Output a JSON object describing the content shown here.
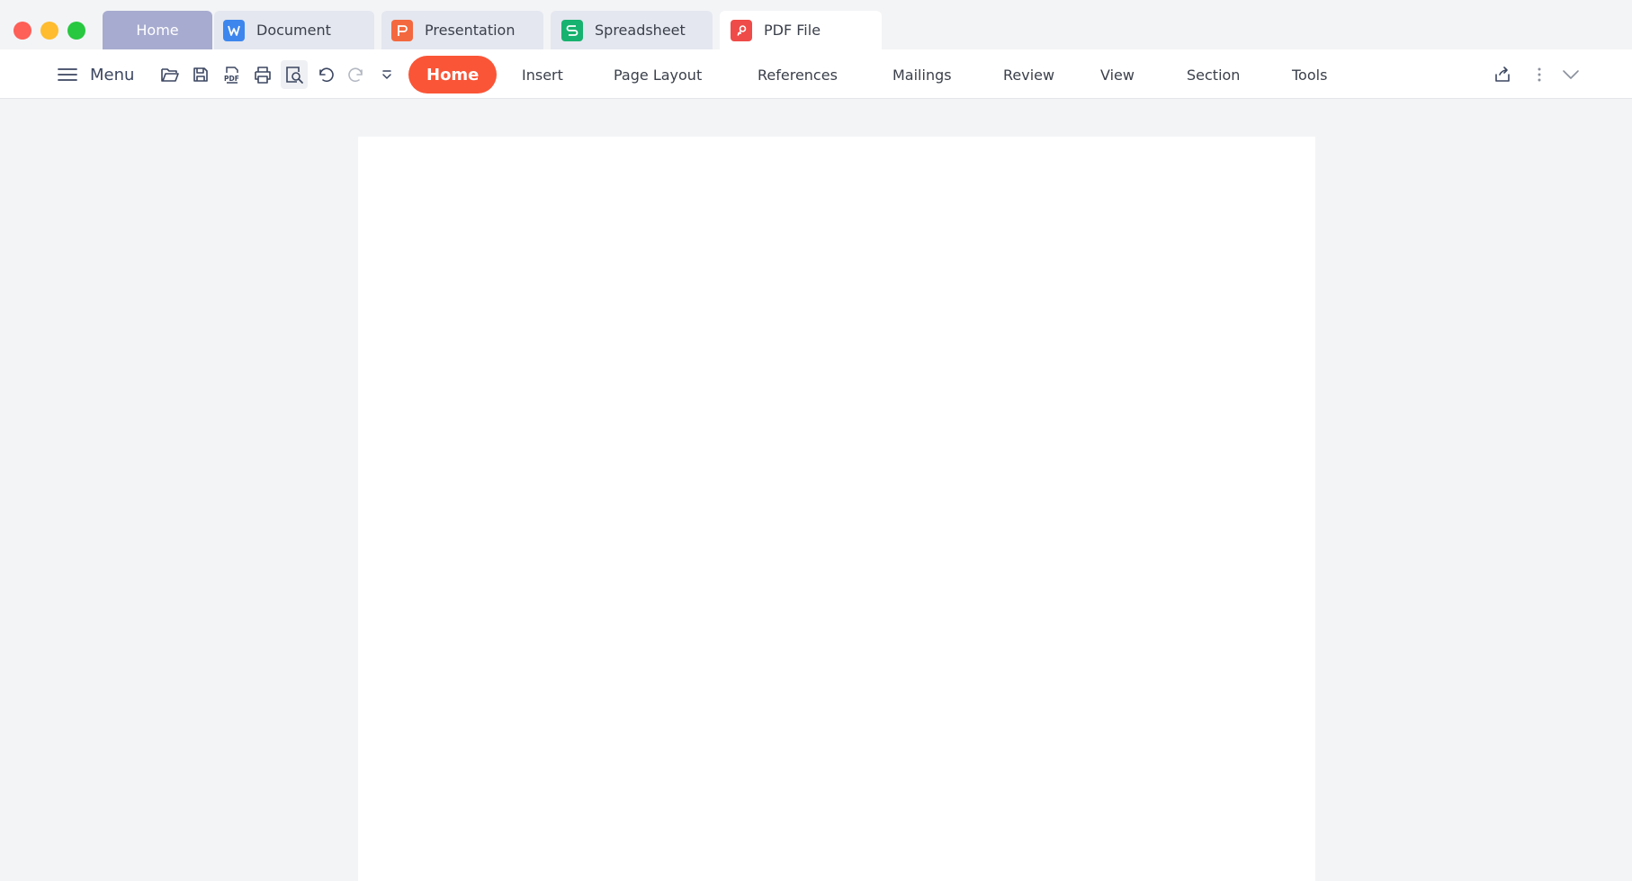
{
  "window": {
    "controls": [
      "close",
      "minimize",
      "maximize"
    ]
  },
  "tabs": [
    {
      "label": "Home",
      "icon": null,
      "active": false
    },
    {
      "label": "Document",
      "icon": "writer-doc-icon",
      "color": "#3d86ee"
    },
    {
      "label": "Presentation",
      "icon": "presentation-icon",
      "color": "#f4683f"
    },
    {
      "label": "Spreadsheet",
      "icon": "spreadsheet-icon",
      "color": "#17b26f"
    },
    {
      "label": "PDF File",
      "icon": "pdf-icon",
      "color": "#ef4b48",
      "active": true
    }
  ],
  "toolbar": {
    "menu_label": "Menu",
    "quick_actions": [
      "open-folder-icon",
      "save-icon",
      "export-pdf-icon",
      "print-icon",
      "print-preview-icon",
      "undo-icon",
      "redo-icon",
      "customize-dropdown-icon"
    ],
    "ribbon_tabs": [
      "Home",
      "Insert",
      "Page Layout",
      "References",
      "Mailings",
      "Review",
      "View",
      "Section",
      "Tools"
    ],
    "active_ribbon_tab": "Home",
    "right_actions": [
      "share-icon",
      "more-options-icon",
      "collapse-ribbon-icon"
    ]
  },
  "colors": {
    "accent": "#fa5537",
    "home_tab": "#a7abcf",
    "background": "#f3f4f6"
  }
}
